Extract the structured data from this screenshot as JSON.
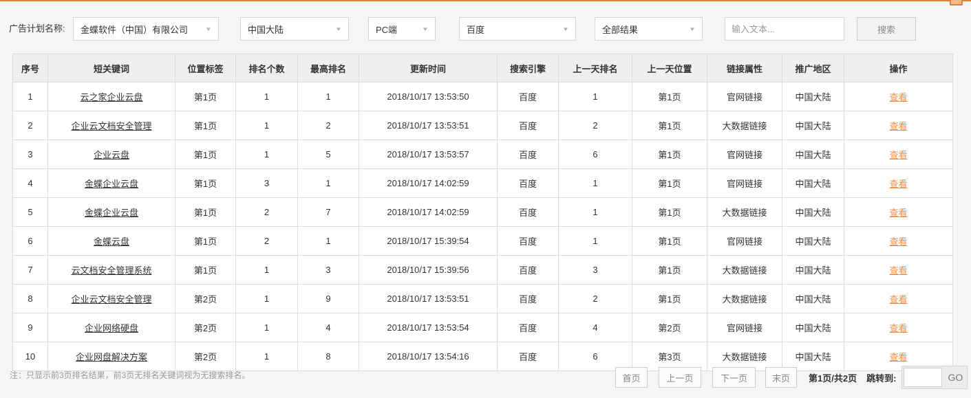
{
  "colors": {
    "accent_orange": "#e2813c",
    "action_link": "#ef8c45"
  },
  "icons": {
    "dropdown_caret": "▼"
  },
  "filters": {
    "label": "广告计划名称:",
    "dropdowns": [
      {
        "name": "ad-plan",
        "value": "金蝶软件（中国）有限公司"
      },
      {
        "name": "region",
        "value": "中国大陆"
      },
      {
        "name": "device",
        "value": "PC端"
      },
      {
        "name": "engine",
        "value": "百度"
      },
      {
        "name": "result-type",
        "value": "全部结果"
      }
    ],
    "search_input": {
      "value": "",
      "placeholder": "输入文本..."
    },
    "search_button": "搜索"
  },
  "table": {
    "columns": [
      "序号",
      "短关键词",
      "位置标签",
      "排名个数",
      "最高排名",
      "更新时间",
      "搜索引擎",
      "上一天排名",
      "上一天位置",
      "链接属性",
      "推广地区",
      "操作"
    ],
    "action_label": "查看",
    "rows": [
      [
        "1",
        "云之家企业云盘",
        "第1页",
        "1",
        "1",
        "2018/10/17 13:53:50",
        "百度",
        "1",
        "第1页",
        "官网链接",
        "中国大陆"
      ],
      [
        "2",
        "企业云文档安全管理",
        "第1页",
        "1",
        "2",
        "2018/10/17 13:53:51",
        "百度",
        "2",
        "第1页",
        "大数据链接",
        "中国大陆"
      ],
      [
        "3",
        "企业云盘",
        "第1页",
        "1",
        "5",
        "2018/10/17 13:53:57",
        "百度",
        "6",
        "第1页",
        "官网链接",
        "中国大陆"
      ],
      [
        "4",
        "金蝶企业云盘",
        "第1页",
        "3",
        "1",
        "2018/10/17 14:02:59",
        "百度",
        "1",
        "第1页",
        "官网链接",
        "中国大陆"
      ],
      [
        "5",
        "金蝶企业云盘",
        "第1页",
        "2",
        "7",
        "2018/10/17 14:02:59",
        "百度",
        "1",
        "第1页",
        "大数据链接",
        "中国大陆"
      ],
      [
        "6",
        "金蝶云盘",
        "第1页",
        "2",
        "1",
        "2018/10/17 15:39:54",
        "百度",
        "1",
        "第1页",
        "官网链接",
        "中国大陆"
      ],
      [
        "7",
        "云文档安全管理系统",
        "第1页",
        "1",
        "3",
        "2018/10/17 15:39:56",
        "百度",
        "3",
        "第1页",
        "大数据链接",
        "中国大陆"
      ],
      [
        "8",
        "企业云文档安全管理",
        "第2页",
        "1",
        "9",
        "2018/10/17 13:53:51",
        "百度",
        "2",
        "第1页",
        "大数据链接",
        "中国大陆"
      ],
      [
        "9",
        "企业网络硬盘",
        "第2页",
        "1",
        "4",
        "2018/10/17 13:53:54",
        "百度",
        "4",
        "第2页",
        "官网链接",
        "中国大陆"
      ],
      [
        "10",
        "企业网盘解决方案",
        "第2页",
        "1",
        "8",
        "2018/10/17 13:54:16",
        "百度",
        "6",
        "第3页",
        "大数据链接",
        "中国大陆"
      ]
    ]
  },
  "footer": {
    "note": "注：只显示前3页排名结果，前3页无排名关键词视为无搜索排名。",
    "pagination": {
      "first": "首页",
      "prev": "上一页",
      "next": "下一页",
      "last": "末页",
      "page_info": "第1页/共2页",
      "jump_label": "跳转到:",
      "jump_value": "",
      "go": "GO"
    }
  }
}
